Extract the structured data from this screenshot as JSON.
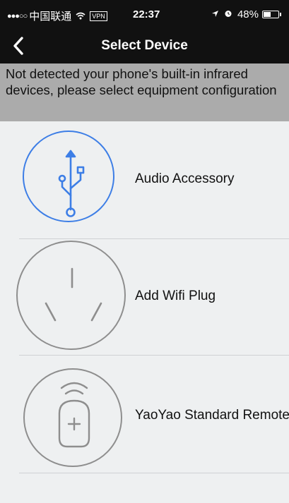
{
  "status_bar": {
    "signal_dots": "●●●○○",
    "carrier": "中国联通",
    "wifi_icon": "wifi-icon",
    "vpn_label": "VPN",
    "time": "22:37",
    "battery_pct": "48%",
    "battery_level": 0.48
  },
  "nav": {
    "title": "Select Device",
    "back_icon": "chevron-left-icon"
  },
  "notice": {
    "text": "Not detected your phone's built-in infrared devices, please select equipment configuration"
  },
  "devices": [
    {
      "label": "Audio Accessory",
      "icon": "usb-icon",
      "selected": true
    },
    {
      "label": "Add Wifi Plug",
      "icon": "wifi-plug-icon",
      "selected": false
    },
    {
      "label": "YaoYao Standard Remote",
      "icon": "remote-add-icon",
      "selected": false
    }
  ],
  "colors": {
    "accent": "#3d7ee6",
    "icon_gray": "#8e8e8e",
    "bar_bg": "#111111",
    "notice_bg": "#ababab",
    "list_bg": "#eef0f1"
  }
}
